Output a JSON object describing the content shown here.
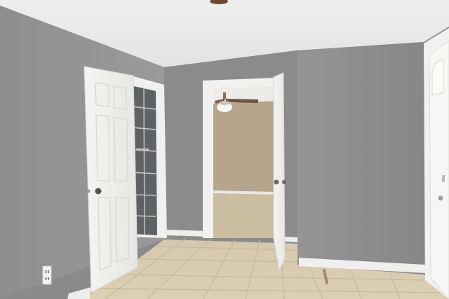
{
  "scene": {
    "description_tag": "empty-room-photo",
    "colors": {
      "ceiling": "#e8e8e6",
      "wall_left": "#8f8f90",
      "wall_back": "#8a8a8b",
      "wall_right": "#8c8c8d",
      "door_white": "#f2f2f0",
      "floor_tile": "#d8c9ad",
      "grout": "#c4b597",
      "carpet": "#cbbd9f",
      "far_wall": "#b8a88e",
      "shower_tile": "#6e7173"
    },
    "icons": [
      "ceiling-fan-icon",
      "outlet-icon",
      "door-knob-icon"
    ]
  }
}
